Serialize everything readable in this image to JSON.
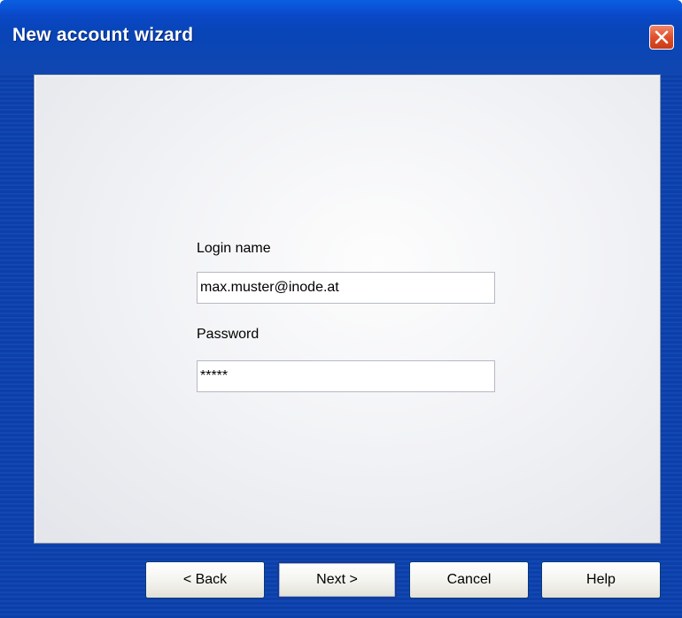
{
  "window": {
    "title": "New account wizard",
    "close_icon": "close-x-icon",
    "accent": "#0a48c8",
    "close_color": "#e0502b"
  },
  "form": {
    "login_label": "Login name",
    "login_value": "max.muster@inode.at",
    "password_label": "Password",
    "password_value": "*****"
  },
  "buttons": {
    "back": "< Back",
    "next": "Next >",
    "cancel": "Cancel",
    "help": "Help"
  }
}
